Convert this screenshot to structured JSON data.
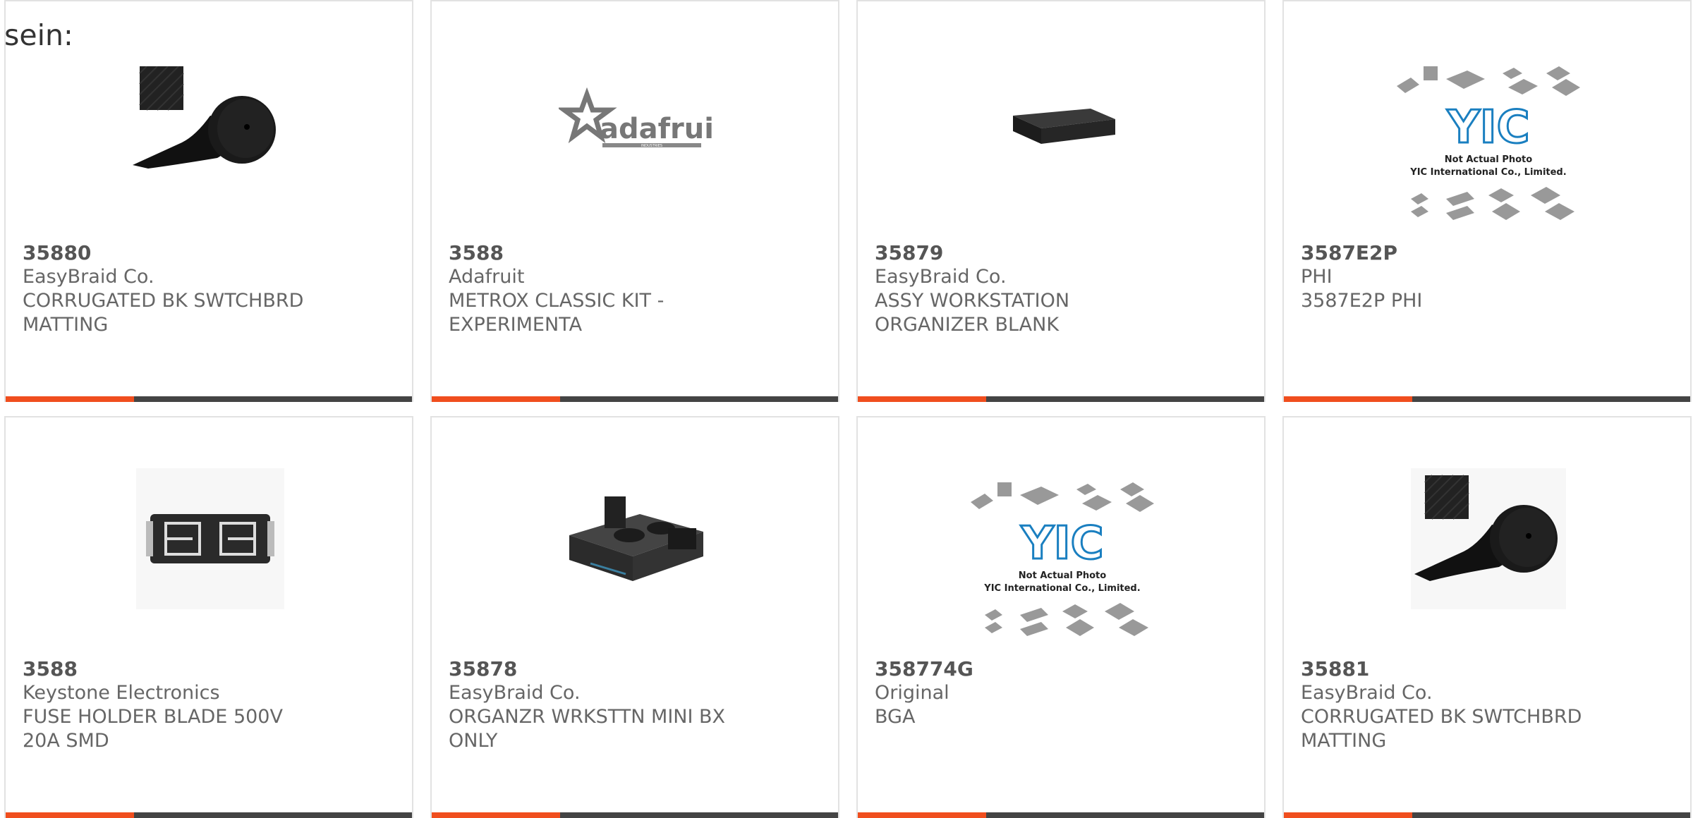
{
  "prefix_text": "sein:",
  "colors": {
    "accent": "#f04e1e",
    "bar": "#444444",
    "border": "#e2e2e2",
    "text": "#666666"
  },
  "products": [
    {
      "part_number": "35880",
      "manufacturer": "EasyBraid Co.",
      "description": "CORRUGATED BK SWTCHBRD MATTING",
      "image": "matting-roll-icon"
    },
    {
      "part_number": "3588",
      "manufacturer": "Adafruit",
      "description": "METROX CLASSIC KIT - EXPERIMENTA",
      "image": "adafruit-logo",
      "logo_text": "adafruit",
      "logo_subtext": "INDUSTRIES"
    },
    {
      "part_number": "35879",
      "manufacturer": "EasyBraid Co.",
      "description": "ASSY WORKSTATION ORGANIZER BLANK",
      "image": "organizer-box-icon"
    },
    {
      "part_number": "3587E2P",
      "manufacturer": "PHI",
      "description": "3587E2P PHI",
      "image": "yic-placeholder",
      "logo_text": "YIC",
      "placeholder_line1": "Not Actual Photo",
      "placeholder_line2": "YIC International Co., Limited."
    },
    {
      "part_number": "3588",
      "manufacturer": "Keystone Electronics",
      "description": "FUSE HOLDER BLADE 500V 20A SMD",
      "image": "fuse-holder-icon"
    },
    {
      "part_number": "35878",
      "manufacturer": "EasyBraid Co.",
      "description": "ORGANZR WRKSTTN MINI BX ONLY",
      "image": "organizer-mini-box-icon"
    },
    {
      "part_number": "358774G",
      "manufacturer": "Original",
      "description": "BGA",
      "image": "yic-placeholder",
      "logo_text": "YIC",
      "placeholder_line1": "Not Actual Photo",
      "placeholder_line2": "YIC International Co., Limited."
    },
    {
      "part_number": "35881",
      "manufacturer": "EasyBraid Co.",
      "description": "CORRUGATED BK SWTCHBRD MATTING",
      "image": "matting-roll-icon"
    }
  ]
}
